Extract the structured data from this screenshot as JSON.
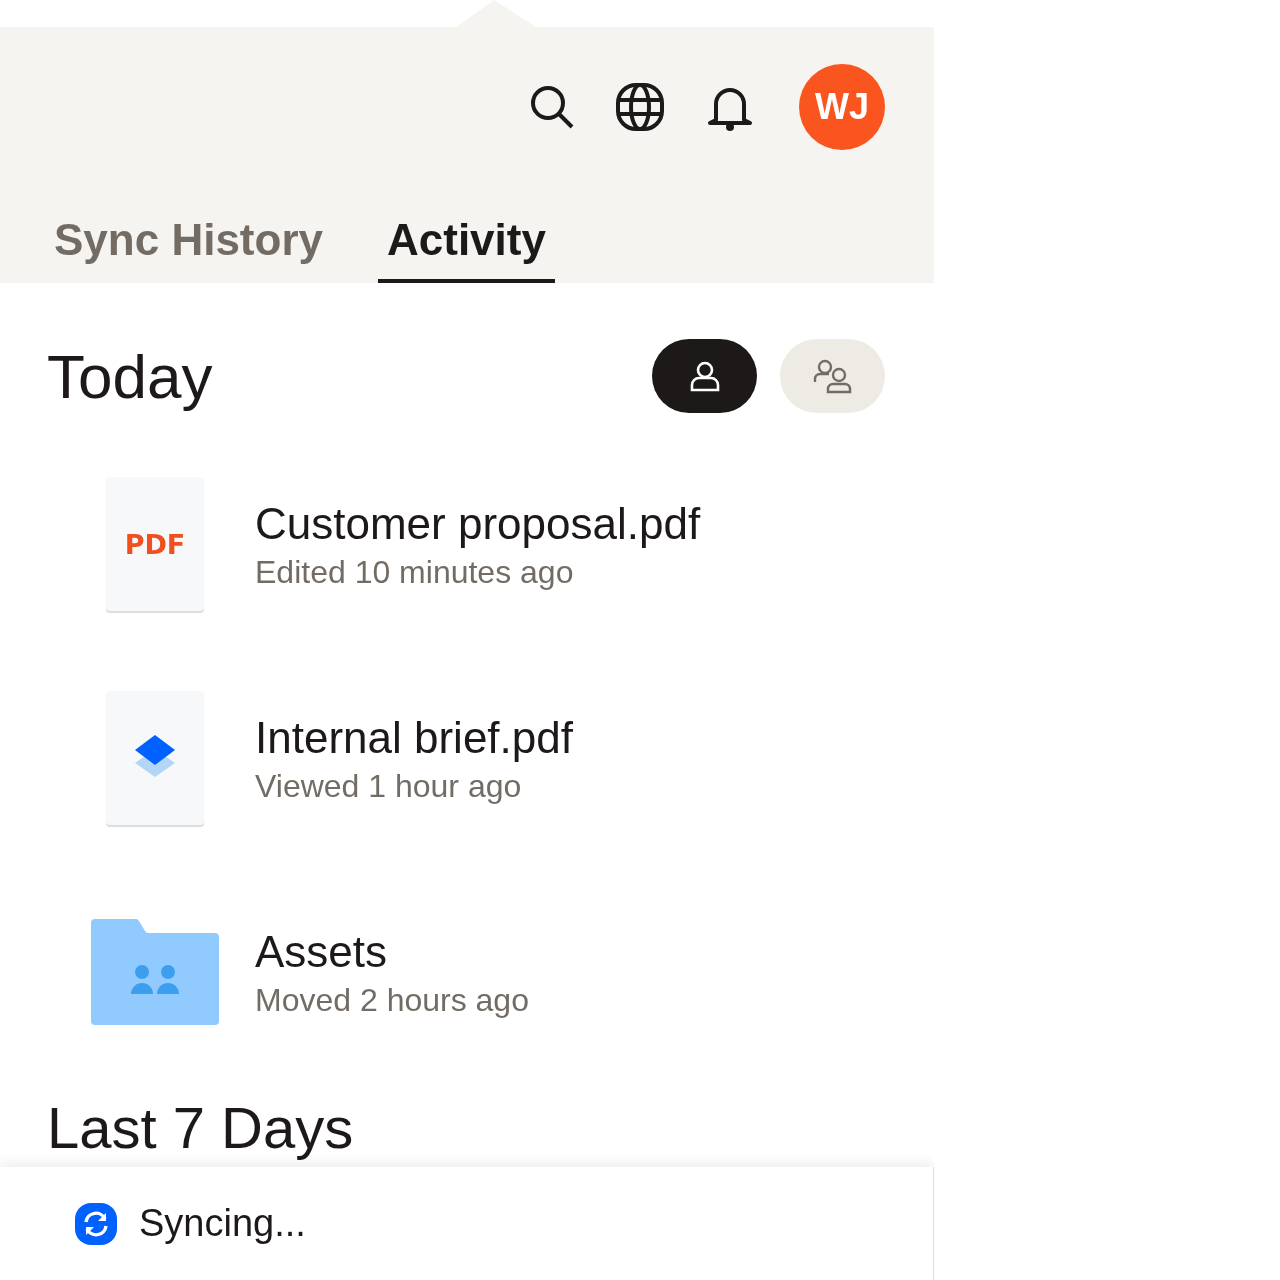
{
  "header": {
    "avatar_initials": "WJ"
  },
  "tabs": [
    {
      "label": "Sync History",
      "selected": false
    },
    {
      "label": "Activity",
      "selected": true
    }
  ],
  "section": {
    "title": "Today",
    "filters": [
      {
        "kind": "me",
        "selected": true
      },
      {
        "kind": "shared",
        "selected": false
      }
    ]
  },
  "items": [
    {
      "kind": "pdf",
      "thumb_label": "PDF",
      "name": "Customer proposal.pdf",
      "detail": "Edited 10 minutes ago"
    },
    {
      "kind": "doc",
      "name": "Internal brief.pdf",
      "detail": "Viewed 1 hour ago"
    },
    {
      "kind": "folder",
      "name": "Assets",
      "detail": "Moved 2 hours ago"
    }
  ],
  "next_section": {
    "title": "Last 7 Days"
  },
  "status_bar": {
    "text": "Syncing..."
  }
}
